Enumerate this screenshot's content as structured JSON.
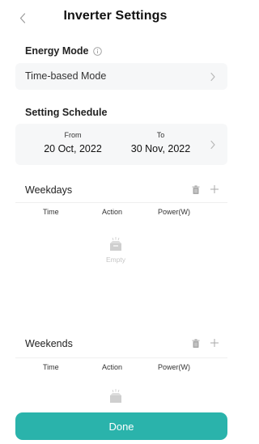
{
  "header": {
    "title": "Inverter Settings",
    "back_icon": "chevron-left-icon"
  },
  "energy_mode": {
    "label": "Energy Mode",
    "info_icon": "info-icon",
    "value": "Time-based Mode"
  },
  "schedule": {
    "label": "Setting Schedule",
    "from_label": "From",
    "from_date": "20 Oct, 2022",
    "to_label": "To",
    "to_date": "30 Nov, 2022"
  },
  "weekdays": {
    "title": "Weekdays",
    "columns": [
      "Time",
      "Action",
      "Power(W)"
    ],
    "empty_text": "Empty"
  },
  "weekends": {
    "title": "Weekends",
    "columns": [
      "Time",
      "Action",
      "Power(W)"
    ]
  },
  "footer": {
    "done_label": "Done"
  },
  "colors": {
    "accent": "#2ab3ab",
    "row_bg": "#f6f7f8",
    "muted": "#c6c6c6"
  }
}
